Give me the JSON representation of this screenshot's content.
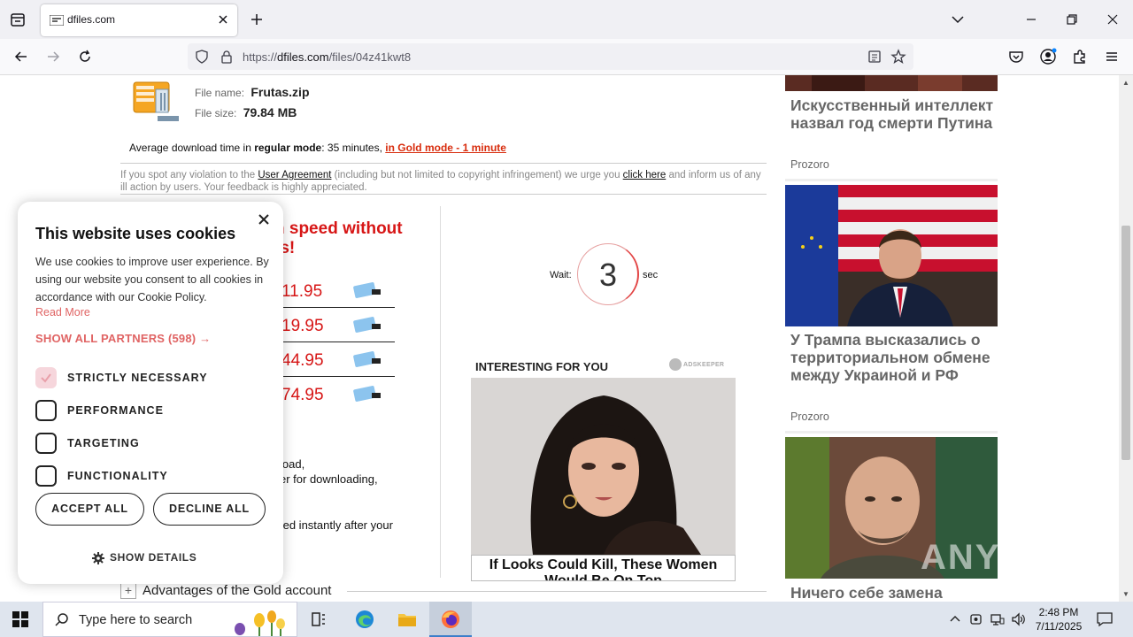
{
  "browser": {
    "tab_title": "dfiles.com",
    "url_prefix": "https://",
    "url_domain": "dfiles.com",
    "url_path": "/files/04z41kwt8"
  },
  "file": {
    "name_label": "File name:",
    "name": "Frutas.zip",
    "size_label": "File size:",
    "size": "79.84 MB"
  },
  "download": {
    "avg_prefix": "Average download time in ",
    "regular_mode": "regular mode",
    "regular_time": ": 35 minutes, ",
    "gold_link": "in Gold mode - 1 minute"
  },
  "notice": {
    "part1": "If you spot any violation to the ",
    "user_agreement": "User Agreement",
    "part2": " (including but not limited to copyright infringement) we urge you ",
    "click_here": "click here",
    "part3": " and inform us of any ill action by users. Your feedback is highly appreciated."
  },
  "gold": {
    "title_line1": "n speed without",
    "title_line2": "ts!",
    "prices": [
      "11.95",
      "19.95",
      "44.95",
      "74.95"
    ],
    "partial_lines": [
      ",",
      "load,",
      "er for downloading,",
      "ted instantly after your"
    ]
  },
  "timer": {
    "wait_label": "Wait:",
    "value": "3",
    "sec_label": "sec"
  },
  "ad": {
    "heading": "INTERESTING FOR YOU",
    "brand": "ADSKEEPER",
    "caption": "If Looks Could Kill, These Women Would Be On Top"
  },
  "advantages": {
    "plus": "+",
    "label": "Advantages of the Gold account"
  },
  "news": [
    {
      "title": "Искусственный интеллект назвал год смерти Путина",
      "source": "Prozoro"
    },
    {
      "title": "У Трампа высказались о территориальном обмене между Украиной и РФ",
      "source": "Prozoro"
    },
    {
      "title": "Ничего себе замена",
      "source": ""
    }
  ],
  "cookie": {
    "title": "This website uses cookies",
    "description": "We use cookies to improve user experience. By using our website you consent to all cookies in accordance with our Cookie Policy.",
    "read_more": "Read More",
    "partners": "SHOW ALL PARTNERS (598) →",
    "options": [
      {
        "label": "STRICTLY NECESSARY",
        "checked": true
      },
      {
        "label": "PERFORMANCE",
        "checked": false
      },
      {
        "label": "TARGETING",
        "checked": false
      },
      {
        "label": "FUNCTIONALITY",
        "checked": false
      }
    ],
    "accept": "ACCEPT ALL",
    "decline": "DECLINE ALL",
    "details": "SHOW DETAILS"
  },
  "taskbar": {
    "search_placeholder": "Type here to search",
    "time": "2:48 PM",
    "date": "7/11/2025"
  },
  "watermark": "ANY RUN",
  "colors": {
    "accent_red": "#d71616",
    "cookie_accent": "#e06464",
    "news_text": "#666666"
  }
}
